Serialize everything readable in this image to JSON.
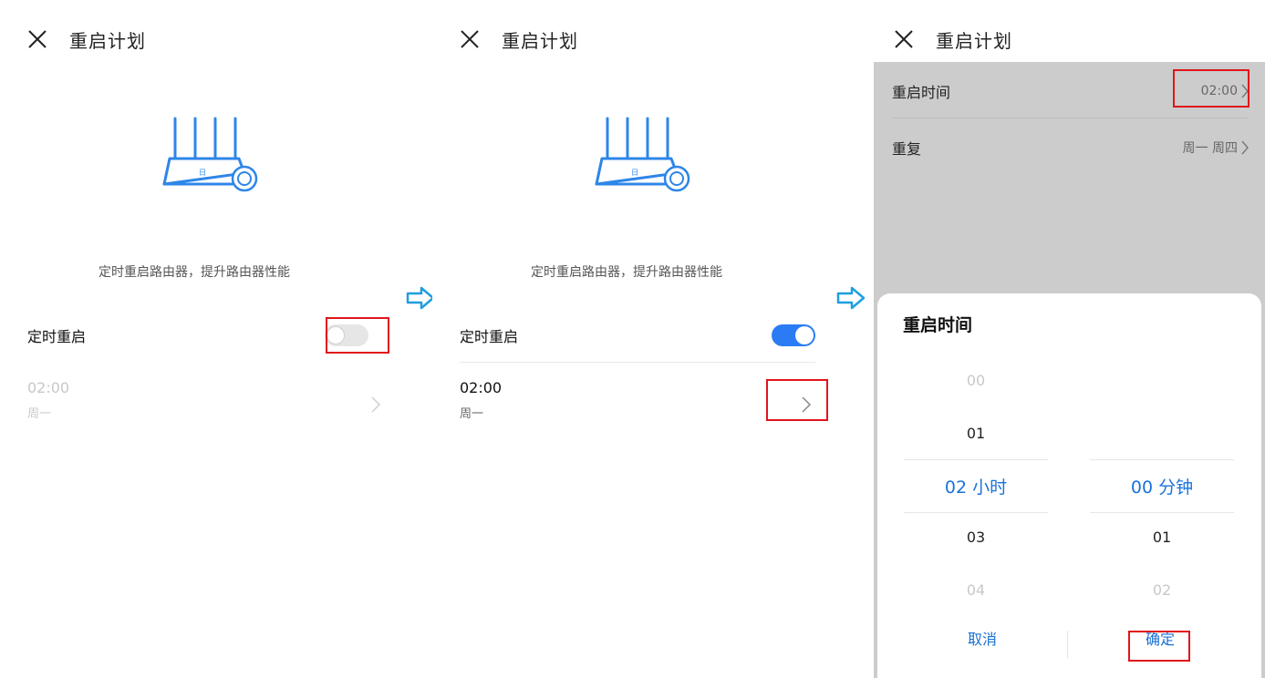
{
  "screen1": {
    "title": "重启计划",
    "description": "定时重启路由器，提升路由器性能",
    "toggle_label": "定时重启",
    "toggle_state": "off",
    "schedule_time": "02:00",
    "schedule_days": "周一"
  },
  "screen2": {
    "title": "重启计划",
    "description": "定时重启路由器，提升路由器性能",
    "toggle_label": "定时重启",
    "toggle_state": "on",
    "schedule_time": "02:00",
    "schedule_days": "周一"
  },
  "screen3": {
    "title": "重启计划",
    "restart_time_label": "重启时间",
    "restart_time_value": "02:00",
    "repeat_label": "重复",
    "repeat_value": "周一 周四",
    "sheet_title": "重启时间",
    "hour_items": [
      "00",
      "01",
      "02 小时",
      "03",
      "04"
    ],
    "minute_items": [
      "00 分钟",
      "01",
      "02"
    ],
    "cancel_label": "取消",
    "confirm_label": "确定"
  },
  "colors": {
    "accent": "#2b7bf4",
    "highlight_box": "#e0151b",
    "arrow": "#1e9ee0",
    "router_line": "#2e86e8"
  }
}
